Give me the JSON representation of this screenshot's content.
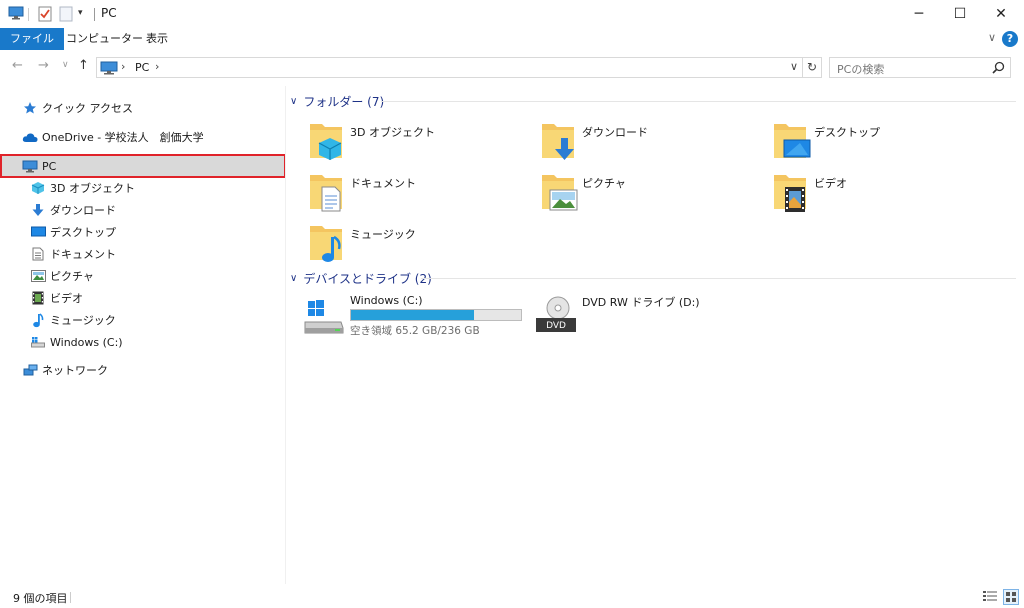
{
  "window": {
    "title": "PC",
    "minimize": "─",
    "maximize": "☐",
    "close": "✕"
  },
  "ribbon": {
    "tabs": [
      {
        "label": "ファイル",
        "active": true
      },
      {
        "label": "コンピューター",
        "active": false
      },
      {
        "label": "表示",
        "active": false
      }
    ],
    "collapse": "∨",
    "help": "?"
  },
  "address": {
    "back": "←",
    "forward": "→",
    "recent": "∨",
    "up": "↑",
    "sep": "›",
    "path": "PC",
    "dropdown": "∨",
    "refresh": "↻"
  },
  "search": {
    "placeholder": "PCの検索"
  },
  "nav": {
    "quick_access": "クイック アクセス",
    "onedrive": "OneDrive - 学校法人　創価大学",
    "pc": "PC",
    "pc_children": [
      {
        "label": "3D オブジェクト",
        "icon": "3d-objects-icon"
      },
      {
        "label": "ダウンロード",
        "icon": "download-icon"
      },
      {
        "label": "デスクトップ",
        "icon": "desktop-icon"
      },
      {
        "label": "ドキュメント",
        "icon": "documents-icon"
      },
      {
        "label": "ピクチャ",
        "icon": "pictures-icon"
      },
      {
        "label": "ビデオ",
        "icon": "videos-icon"
      },
      {
        "label": "ミュージック",
        "icon": "music-icon"
      },
      {
        "label": "Windows (C:)",
        "icon": "drive-icon"
      }
    ],
    "network": "ネットワーク"
  },
  "content": {
    "folders_header": "フォルダー (7)",
    "folders": [
      {
        "label": "3D オブジェクト",
        "icon": "3d-objects-folder-icon"
      },
      {
        "label": "ダウンロード",
        "icon": "downloads-folder-icon"
      },
      {
        "label": "デスクトップ",
        "icon": "desktop-folder-icon"
      },
      {
        "label": "ドキュメント",
        "icon": "documents-folder-icon"
      },
      {
        "label": "ピクチャ",
        "icon": "pictures-folder-icon"
      },
      {
        "label": "ビデオ",
        "icon": "videos-folder-icon"
      },
      {
        "label": "ミュージック",
        "icon": "music-folder-icon"
      }
    ],
    "devices_header": "デバイスとドライブ (2)",
    "drives": [
      {
        "label": "Windows (C:)",
        "free_text": "空き領域 65.2 GB/236 GB",
        "used_fraction": 0.724
      },
      {
        "label": "DVD RW ドライブ (D:)",
        "badge": "DVD"
      }
    ]
  },
  "status": {
    "count": "9 個の項目"
  },
  "colors": {
    "accent": "#1979ca",
    "selection_outline": "#e0232a",
    "group_header": "#1e3287",
    "drive_bar": "#26a0da",
    "folder": "#f4c560"
  }
}
